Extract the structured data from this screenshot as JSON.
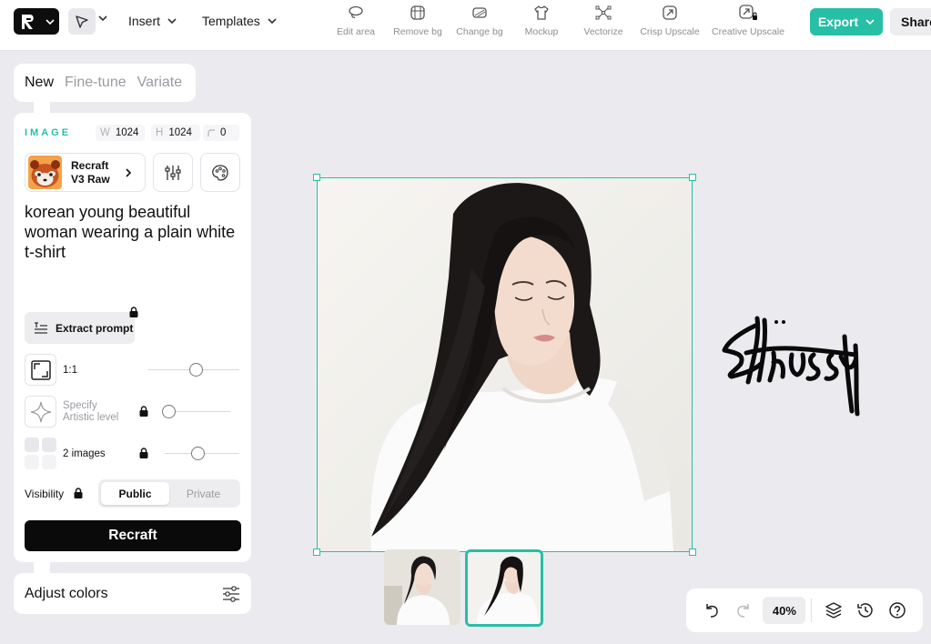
{
  "topbar": {
    "menus": {
      "insert": "Insert",
      "templates": "Templates"
    },
    "tools": [
      {
        "label": "Edit area",
        "icon": "lasso-icon"
      },
      {
        "label": "Remove bg",
        "icon": "remove-bg-icon"
      },
      {
        "label": "Change bg",
        "icon": "change-bg-icon"
      },
      {
        "label": "Mockup",
        "icon": "tshirt-icon"
      },
      {
        "label": "Vectorize",
        "icon": "vectorize-icon"
      },
      {
        "label": "Crisp Upscale",
        "icon": "upscale-icon"
      },
      {
        "label": "Creative Upscale",
        "icon": "creative-upscale-icon"
      }
    ],
    "export": "Export",
    "share": "Share"
  },
  "mode_tabs": {
    "new": "New",
    "finetune": "Fine-tune",
    "variate": "Variate",
    "active": "New"
  },
  "panel": {
    "section_label": "IMAGE",
    "width_key": "W",
    "width": "1024",
    "height_key": "H",
    "height": "1024",
    "corner": "0",
    "model": {
      "line1": "Recraft",
      "line2": "V3 Raw"
    },
    "prompt": "korean young beautiful woman wearing a plain white t-shirt",
    "extract_prompt": "Extract prompt",
    "aspect_ratio": "1:1",
    "artistic_level": {
      "line1": "Specify",
      "line2": "Artistic level"
    },
    "images_count": "2 images",
    "visibility": "Visibility",
    "visibility_options": [
      "Public",
      "Private"
    ],
    "visibility_selected": "Public",
    "recraft_button": "Recraft",
    "sliders": {
      "aspect": 0.45,
      "artistic": 0.0,
      "images": 0.35
    }
  },
  "adjust_colors": "Adjust colors",
  "bottombar": {
    "zoom": "40%"
  },
  "colors": {
    "accent": "#27bfa6",
    "dark": "#0a0a0a",
    "canvas_bg": "#ebebef"
  }
}
